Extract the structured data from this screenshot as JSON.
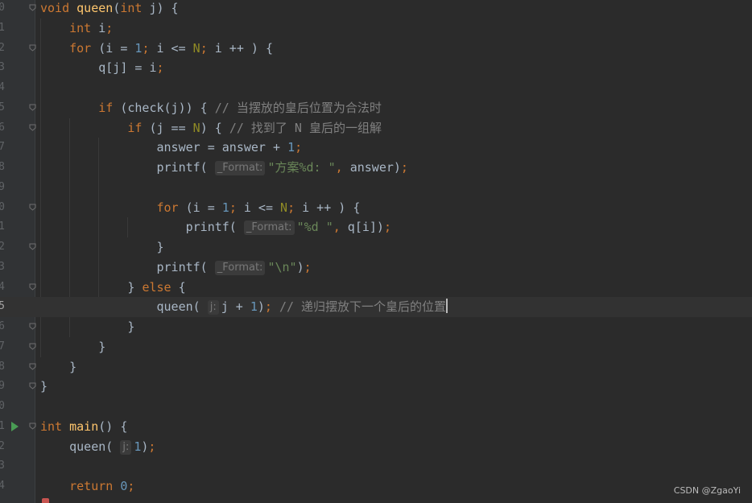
{
  "editor": {
    "lines": [
      {
        "num": "0",
        "tokens": [
          {
            "t": "void ",
            "c": "kw"
          },
          {
            "t": "queen",
            "c": "fn"
          },
          {
            "t": "(",
            "c": ""
          },
          {
            "t": "int ",
            "c": "kw"
          },
          {
            "t": "j) {",
            "c": ""
          }
        ]
      },
      {
        "num": "1",
        "tokens": [
          {
            "t": "    "
          },
          {
            "t": "int ",
            "c": "kw"
          },
          {
            "t": "i",
            "c": ""
          },
          {
            "t": ";",
            "c": "semi"
          }
        ]
      },
      {
        "num": "2",
        "tokens": [
          {
            "t": "    "
          },
          {
            "t": "for ",
            "c": "kw"
          },
          {
            "t": "(i = ",
            "c": ""
          },
          {
            "t": "1",
            "c": "num"
          },
          {
            "t": "; ",
            "c": "semi"
          },
          {
            "t": "i <= ",
            "c": ""
          },
          {
            "t": "N",
            "c": "macro"
          },
          {
            "t": "; ",
            "c": "semi"
          },
          {
            "t": "i ++ ) {",
            "c": ""
          }
        ]
      },
      {
        "num": "3",
        "tokens": [
          {
            "t": "        "
          },
          {
            "t": "q[j] = i",
            "c": ""
          },
          {
            "t": ";",
            "c": "semi"
          }
        ]
      },
      {
        "num": "4",
        "tokens": []
      },
      {
        "num": "5",
        "tokens": [
          {
            "t": "        "
          },
          {
            "t": "if ",
            "c": "kw"
          },
          {
            "t": "(check(j)) { ",
            "c": ""
          },
          {
            "t": "// 当摆放的皇后位置为合法时",
            "c": "cmt"
          }
        ]
      },
      {
        "num": "6",
        "tokens": [
          {
            "t": "            "
          },
          {
            "t": "if ",
            "c": "kw"
          },
          {
            "t": "(j == ",
            "c": ""
          },
          {
            "t": "N",
            "c": "macro"
          },
          {
            "t": ") { ",
            "c": ""
          },
          {
            "t": "// 找到了 N 皇后的一组解",
            "c": "cmt"
          }
        ]
      },
      {
        "num": "7",
        "tokens": [
          {
            "t": "                "
          },
          {
            "t": "answer = answer + ",
            "c": ""
          },
          {
            "t": "1",
            "c": "num"
          },
          {
            "t": ";",
            "c": "semi"
          }
        ]
      },
      {
        "num": "8",
        "tokens": [
          {
            "t": "                "
          },
          {
            "t": "printf( ",
            "c": ""
          },
          {
            "t": "_Format:",
            "c": "hint"
          },
          {
            "t": "\"方案%d: \"",
            "c": "str"
          },
          {
            "t": ", ",
            "c": "semi"
          },
          {
            "t": "answer)",
            "c": ""
          },
          {
            "t": ";",
            "c": "semi"
          }
        ]
      },
      {
        "num": "9",
        "tokens": []
      },
      {
        "num": "0",
        "tokens": [
          {
            "t": "                "
          },
          {
            "t": "for ",
            "c": "kw"
          },
          {
            "t": "(i = ",
            "c": ""
          },
          {
            "t": "1",
            "c": "num"
          },
          {
            "t": "; ",
            "c": "semi"
          },
          {
            "t": "i <= ",
            "c": ""
          },
          {
            "t": "N",
            "c": "macro"
          },
          {
            "t": "; ",
            "c": "semi"
          },
          {
            "t": "i ++ ) {",
            "c": ""
          }
        ]
      },
      {
        "num": "1",
        "tokens": [
          {
            "t": "                    "
          },
          {
            "t": "printf( ",
            "c": ""
          },
          {
            "t": "_Format:",
            "c": "hint"
          },
          {
            "t": "\"%d \"",
            "c": "str"
          },
          {
            "t": ", ",
            "c": "semi"
          },
          {
            "t": "q[i])",
            "c": ""
          },
          {
            "t": ";",
            "c": "semi"
          }
        ]
      },
      {
        "num": "2",
        "tokens": [
          {
            "t": "                "
          },
          {
            "t": "}",
            "c": ""
          }
        ]
      },
      {
        "num": "3",
        "tokens": [
          {
            "t": "                "
          },
          {
            "t": "printf( ",
            "c": ""
          },
          {
            "t": "_Format:",
            "c": "hint"
          },
          {
            "t": "\"\\n\"",
            "c": "str"
          },
          {
            "t": ")",
            "c": ""
          },
          {
            "t": ";",
            "c": "semi"
          }
        ]
      },
      {
        "num": "4",
        "tokens": [
          {
            "t": "            "
          },
          {
            "t": "} ",
            "c": ""
          },
          {
            "t": "else ",
            "c": "kw"
          },
          {
            "t": "{",
            "c": ""
          }
        ]
      },
      {
        "num": "5",
        "current": true,
        "tokens": [
          {
            "t": "                "
          },
          {
            "t": "queen( ",
            "c": ""
          },
          {
            "t": "j:",
            "c": "hint"
          },
          {
            "t": "j + ",
            "c": ""
          },
          {
            "t": "1",
            "c": "num"
          },
          {
            "t": ")",
            "c": ""
          },
          {
            "t": "; ",
            "c": "semi"
          },
          {
            "t": "// 递归摆放下一个皇后的位置",
            "c": "cmt"
          },
          {
            "t": "",
            "c": "caret"
          }
        ]
      },
      {
        "num": "6",
        "tokens": [
          {
            "t": "            "
          },
          {
            "t": "}",
            "c": ""
          }
        ]
      },
      {
        "num": "7",
        "tokens": [
          {
            "t": "        "
          },
          {
            "t": "}",
            "c": ""
          }
        ]
      },
      {
        "num": "8",
        "tokens": [
          {
            "t": "    "
          },
          {
            "t": "}",
            "c": ""
          }
        ]
      },
      {
        "num": "9",
        "tokens": [
          {
            "t": "}",
            "c": ""
          }
        ]
      },
      {
        "num": "0",
        "tokens": []
      },
      {
        "num": "1",
        "run": true,
        "tokens": [
          {
            "t": "int ",
            "c": "kw"
          },
          {
            "t": "main",
            "c": "fn"
          },
          {
            "t": "() {",
            "c": ""
          }
        ]
      },
      {
        "num": "2",
        "tokens": [
          {
            "t": "    "
          },
          {
            "t": "queen( ",
            "c": ""
          },
          {
            "t": "j:",
            "c": "hint"
          },
          {
            "t": "1",
            "c": "num"
          },
          {
            "t": ")",
            "c": ""
          },
          {
            "t": ";",
            "c": "semi"
          }
        ]
      },
      {
        "num": "3",
        "tokens": []
      },
      {
        "num": "4",
        "tokens": [
          {
            "t": "    "
          },
          {
            "t": "return ",
            "c": "kw"
          },
          {
            "t": "0",
            "c": "num"
          },
          {
            "t": ";",
            "c": "semi"
          }
        ]
      }
    ],
    "folds": [
      0,
      2,
      5,
      6,
      10,
      12,
      14,
      16,
      17,
      18,
      19,
      21
    ]
  },
  "watermark": "CSDN @ZgaoYi",
  "colors": {
    "background": "#2b2b2b",
    "gutter": "#313335",
    "keyword": "#cc7832",
    "function": "#ffc66d",
    "number": "#6897bb",
    "string": "#6a8759",
    "comment": "#808080",
    "macro": "#908b25"
  }
}
